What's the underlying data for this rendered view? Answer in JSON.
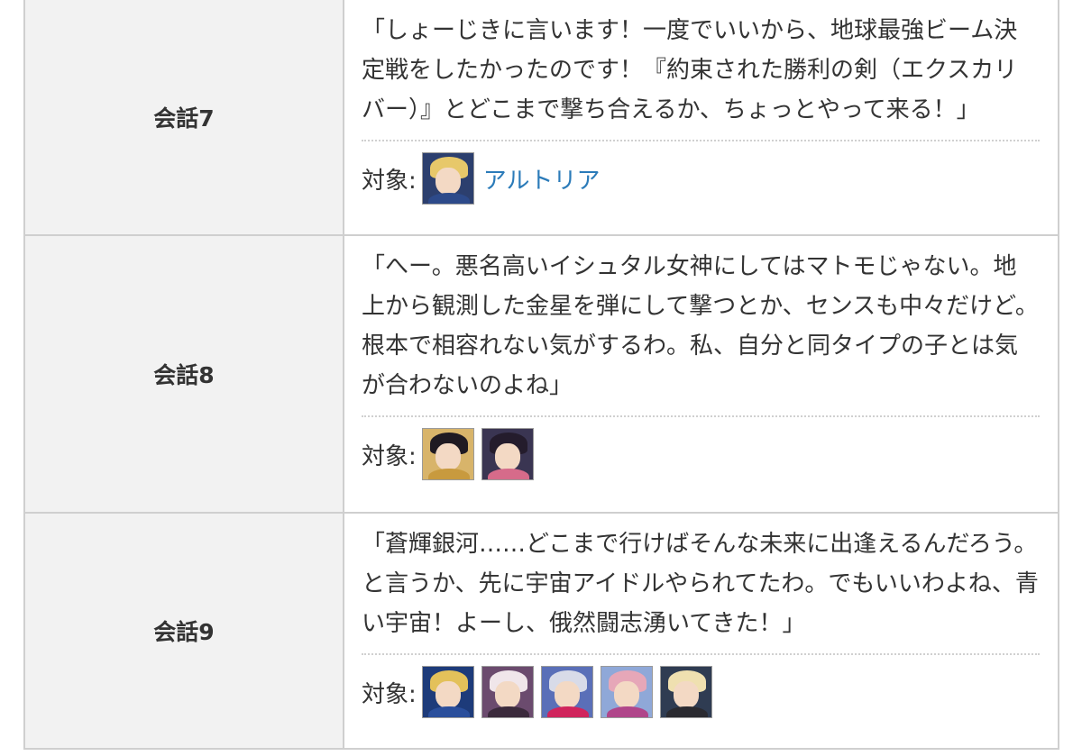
{
  "rows": [
    {
      "label": "会話7",
      "quote": "「しょーじきに言います！一度でいいから、地球最強ビーム決定戦をしたかったのです！『約束された勝利の剣（エクスカリバー）』とどこまで撃ち合えるか、ちょっとやって来る！」",
      "target_label": "対象:",
      "target_link": "アルトリア",
      "avatars": [
        {
          "name": "artoria",
          "bg": "#2c3f6e",
          "hair": "#e7c86a",
          "body": "#2d4a8a"
        }
      ]
    },
    {
      "label": "会話8",
      "quote": "「へー。悪名高いイシュタル女神にしてはマトモじゃない。地上から観測した金星を弾にして撃つとか、センスも中々だけど。根本で相容れない気がするわ。私、自分と同タイプの子とは気が合わないのよね」",
      "target_label": "対象:",
      "target_link": "",
      "avatars": [
        {
          "name": "ishtar-1",
          "bg": "#d8b46a",
          "hair": "#1f1a22",
          "body": "#c89a3e"
        },
        {
          "name": "ishtar-2",
          "bg": "#3a3552",
          "hair": "#241c2c",
          "body": "#d66b8a"
        }
      ]
    },
    {
      "label": "会話9",
      "quote": "「蒼輝銀河……どこまで行けばそんな未来に出逢えるんだろう。と言うか、先に宇宙アイドルやられてたわ。でもいいわよね、青い宇宙！よーし、俄然闘志湧いてきた！」",
      "target_label": "対象:",
      "target_link": "",
      "avatars": [
        {
          "name": "heroine-x",
          "bg": "#1d3b7a",
          "hair": "#e3c15a",
          "body": "#2a4f9c"
        },
        {
          "name": "heroine-x-alter",
          "bg": "#6b4b6e",
          "hair": "#f0e6ea",
          "body": "#3b2a3c"
        },
        {
          "name": "mysterious-heroine-xx",
          "bg": "#5a6fb8",
          "hair": "#d8dbe8",
          "body": "#d0245c"
        },
        {
          "name": "space-ishtar-pink",
          "bg": "#8fa8d8",
          "hair": "#e6a7b8",
          "body": "#b0468a"
        },
        {
          "name": "mysterious-idol-x",
          "bg": "#2f3c52",
          "hair": "#efe0b0",
          "body": "#2a2a30"
        }
      ]
    }
  ]
}
